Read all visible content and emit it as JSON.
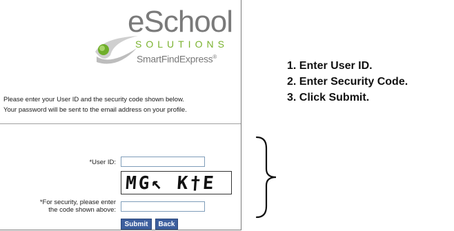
{
  "logo": {
    "brand_word": "eSchool",
    "brand_sub": "SOLUTIONS",
    "product": "SmartFindExpress",
    "product_mark": "®",
    "colors": {
      "gray": "#7a7a7a",
      "green": "#7ab22e",
      "swoosh": "#c8c8c8"
    }
  },
  "intro": {
    "line1": "Please enter your User ID and the security code shown below.",
    "line2": "Your password will be sent to the email address on your profile."
  },
  "form": {
    "user_id_label": "*User ID:",
    "user_id_value": "",
    "captcha_text": "MG↖ K†E",
    "security_label_line1": "*For security, please enter",
    "security_label_line2": "the code shown above:",
    "security_value": "",
    "submit_label": "Submit",
    "back_label": "Back",
    "button_color": "#3d5f9e"
  },
  "instructions": [
    "1. Enter User ID.",
    "2. Enter Security Code.",
    "3. Click Submit."
  ]
}
